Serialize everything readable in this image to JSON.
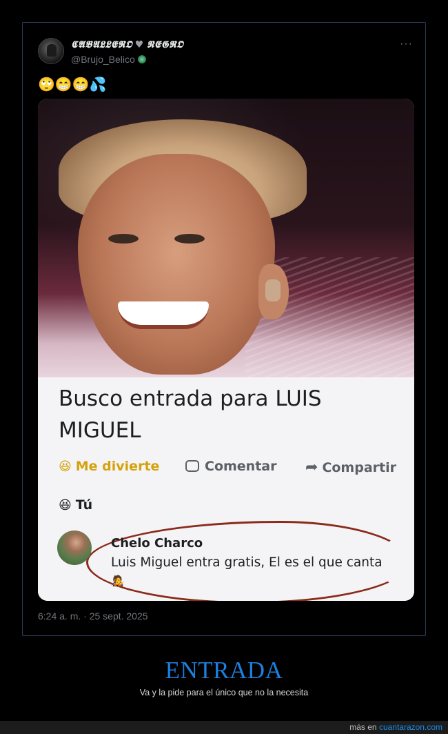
{
  "tweet": {
    "display_name": "𝕮𝕬𝕭𝕬𝕷𝕷𝕰𝕽𝕺",
    "display_name_suffix": "𝕹𝕰𝕲𝕽𝕺",
    "handle": "@Brujo_Belico",
    "text": "🙄😁😁💦",
    "more_label": "···",
    "timestamp": "6:24 a. m. · 25 sept. 2025"
  },
  "post": {
    "title": "Busco entrada para LUIS MIGUEL",
    "react_label": "Me divierte",
    "comment_label": "Comentar",
    "share_label": "Compartir",
    "you_label": "Tú",
    "comment_author": "Chelo Charco",
    "comment_text": "Luis Miguel entra gratis, El es el que canta"
  },
  "page": {
    "headline": "ENTRADA",
    "caption": "Va y la pide para el único que no la necesita",
    "footer_prefix": "más en",
    "footer_link": "cuantarazon.com"
  },
  "colors": {
    "headline": "#1d7fe0",
    "card_border": "#2f3a5a",
    "react": "#d4a20b",
    "circle": "#8a2b1b"
  }
}
